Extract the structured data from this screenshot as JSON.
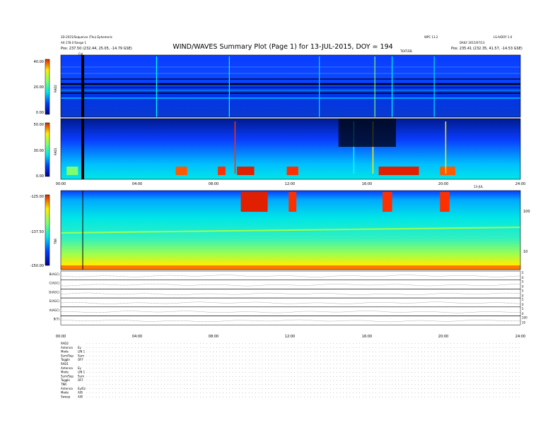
{
  "header": {
    "title": "WIND/WAVES Summary Plot (Page 1) for 13-JUL-2015, DOY = 194",
    "left_line1": "2D-2015/Sequence (Thu) Ephemeris",
    "left_line2": "Alt 178.0  Range 1",
    "left_line3": "Pos: 237.50 (232.44, 25.05, -14.79 GSE)",
    "right_line1": "WPC 13.2",
    "right_line2": "DAILY 2015/07/13",
    "right_line3": "Pos: 235.41 (232.35, 41.57, -14.53 GSE)",
    "right_corner": "LS-A/DOY 1.0",
    "mid_tag": "TEXT/EB",
    "cal_label": "Cal"
  },
  "colors": {
    "background_low": "#00008f",
    "cold": "#0a3cff",
    "mid": "#00e6e6",
    "warm": "#ffee00",
    "hot": "#e03000"
  },
  "chart_data": [
    {
      "type": "heatmap",
      "name": "rad2",
      "ylabel": "RAD2",
      "yticks": [
        "40.00",
        "20.00",
        "0.00"
      ],
      "ylim": [
        0,
        40
      ],
      "xlim": [
        0,
        24
      ]
    },
    {
      "type": "heatmap",
      "name": "rad1",
      "ylabel": "RAD1",
      "yticks": [
        "50.00",
        "30.00",
        "0.00"
      ],
      "ylim": [
        0,
        50
      ],
      "xlim": [
        0,
        24
      ],
      "xticks": [
        "00:00",
        "04:00",
        "08:00",
        "12:00",
        "16:00",
        "20:00",
        "24:00"
      ],
      "x_end_label": "13-JUL"
    },
    {
      "type": "heatmap",
      "name": "tnr",
      "ylabel": "TNR",
      "yticks": [
        "-125.00",
        "-137.50",
        "-150.00"
      ],
      "ylim": [
        -150,
        -125
      ],
      "right_ticks": [
        "100",
        "10"
      ],
      "xlim": [
        0,
        24
      ]
    },
    {
      "type": "line",
      "name": "param-panels",
      "panels": [
        {
          "label": "B(AGC)",
          "right_ticks": [
            "5",
            "0"
          ]
        },
        {
          "label": "C(AGC)",
          "right_ticks": [
            "5",
            "0"
          ]
        },
        {
          "label": "D(AGC)",
          "right_ticks": [
            "5",
            "0"
          ]
        },
        {
          "label": "E(AGC)",
          "right_ticks": [
            "5",
            "0"
          ]
        },
        {
          "label": "A(AGC)",
          "right_ticks": [
            "5",
            "0"
          ]
        },
        {
          "label": "B(T)",
          "right_ticks": [
            "100",
            "10"
          ]
        }
      ],
      "xticks": [
        "00:00",
        "04:00",
        "08:00",
        "12:00",
        "16:00",
        "20:00",
        "24:00"
      ]
    }
  ],
  "status_table": {
    "rows": [
      {
        "label": "RAD2",
        "value": ""
      },
      {
        "label": "Antenna",
        "value": "Ey"
      },
      {
        "label": "Mode",
        "value": "LIN 1"
      },
      {
        "label": "Sum/Sep",
        "value": "Sum"
      },
      {
        "label": "Toggle",
        "value": "OFF"
      },
      {
        "label": "RAD1",
        "value": ""
      },
      {
        "label": "Antenna",
        "value": "Ey"
      },
      {
        "label": "Mode",
        "value": "LIN 1"
      },
      {
        "label": "Sum/Sep",
        "value": "Sum"
      },
      {
        "label": "Toggle",
        "value": "OFF"
      },
      {
        "label": "TNR",
        "value": ""
      },
      {
        "label": "Antenna",
        "value": "Ey/Ez"
      },
      {
        "label": "Mode",
        "value": "A/B"
      },
      {
        "label": "Sweep",
        "value": "A/B"
      }
    ]
  }
}
